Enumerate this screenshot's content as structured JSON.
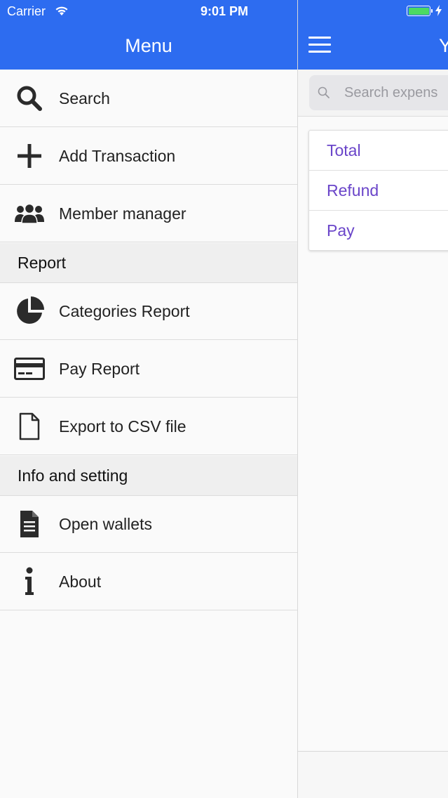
{
  "status_bar": {
    "carrier": "Carrier",
    "time": "9:01 PM",
    "battery_color": "#4cd964"
  },
  "colors": {
    "header_bg": "#2d6cf0",
    "accent_text": "#6a45c9"
  },
  "menu": {
    "title": "Menu",
    "items_top": [
      {
        "label": "Search",
        "icon": "search-icon"
      },
      {
        "label": "Add Transaction",
        "icon": "plus-icon"
      },
      {
        "label": "Member manager",
        "icon": "users-icon"
      }
    ],
    "report_section": {
      "title": "Report",
      "items": [
        {
          "label": "Categories Report",
          "icon": "pie-chart-icon"
        },
        {
          "label": "Pay Report",
          "icon": "credit-card-icon"
        },
        {
          "label": "Export to CSV file",
          "icon": "file-icon"
        }
      ]
    },
    "info_section": {
      "title": "Info and setting",
      "items": [
        {
          "label": "Open wallets",
          "icon": "document-icon"
        },
        {
          "label": "About",
          "icon": "info-icon"
        }
      ]
    }
  },
  "main": {
    "title_partial": "Y",
    "search_placeholder": "Search expens",
    "summary": [
      {
        "label": "Total"
      },
      {
        "label": "Refund"
      },
      {
        "label": "Pay"
      }
    ]
  }
}
